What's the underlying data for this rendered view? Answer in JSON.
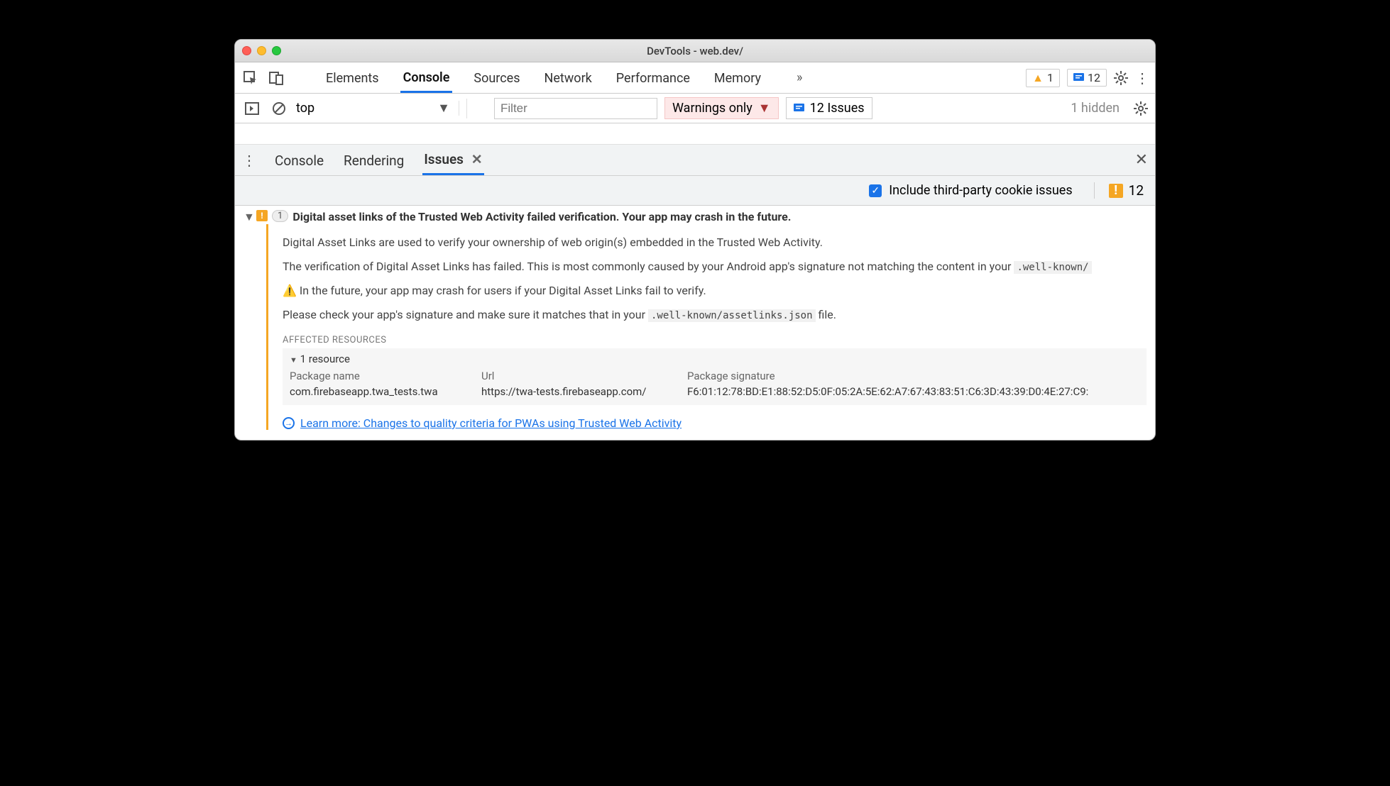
{
  "window": {
    "title": "DevTools - web.dev/"
  },
  "toolbar": {
    "tabs": [
      "Elements",
      "Console",
      "Sources",
      "Network",
      "Performance",
      "Memory"
    ],
    "active_tab": "Console",
    "warnings_count": "1",
    "messages_count": "12"
  },
  "subbar": {
    "context": "top",
    "filter_placeholder": "Filter",
    "level": "Warnings only",
    "issues_label": "12 Issues",
    "hidden_label": "1 hidden"
  },
  "drawer": {
    "tabs": [
      "Console",
      "Rendering",
      "Issues"
    ],
    "active": "Issues",
    "include_label": "Include third-party cookie issues",
    "total_count": "12"
  },
  "issue": {
    "count": "1",
    "title": "Digital asset links of the Trusted Web Activity failed verification. Your app may crash in the future.",
    "p1": "Digital Asset Links are used to verify your ownership of web origin(s) embedded in the Trusted Web Activity.",
    "p2_pre": "The verification of Digital Asset Links has failed. This is most commonly caused by your Android app's signature not matching the content in your ",
    "p2_code": ".well-known/",
    "p3": "In the future, your app may crash for users if your Digital Asset Links fail to verify.",
    "p4_pre": "Please check your app's signature and make sure it matches that in your ",
    "p4_code": ".well-known/assetlinks.json",
    "p4_post": " file.",
    "affected_label": "AFFECTED RESOURCES",
    "resource_header": "1 resource",
    "columns": {
      "c1": "Package name",
      "c2": "Url",
      "c3": "Package signature"
    },
    "row": {
      "package": "com.firebaseapp.twa_tests.twa",
      "url": "https://twa-tests.firebaseapp.com/",
      "signature": "F6:01:12:78:BD:E1:88:52:D5:0F:05:2A:5E:62:A7:67:43:83:51:C6:3D:43:39:D0:4E:27:C9:"
    },
    "learn_more": "Learn more: Changes to quality criteria for PWAs using Trusted Web Activity"
  }
}
